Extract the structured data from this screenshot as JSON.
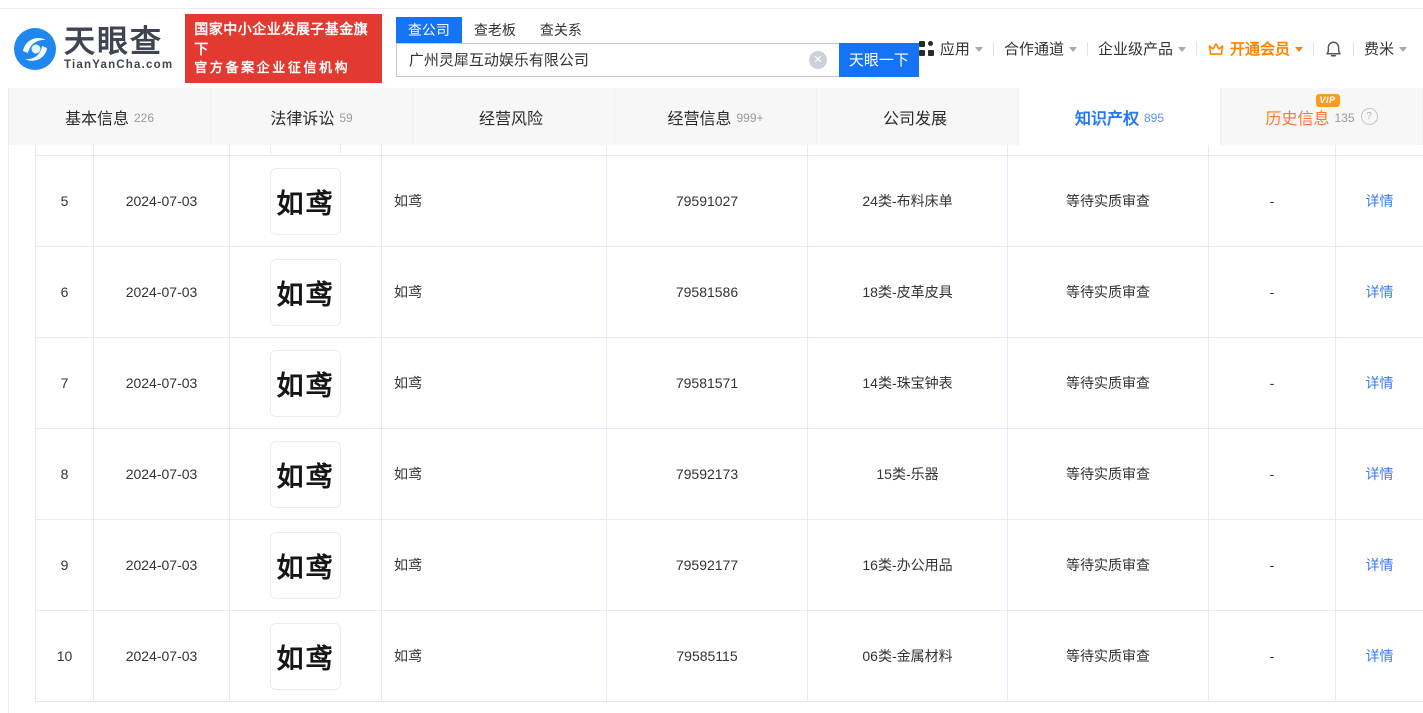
{
  "brand": {
    "logo_title": "天眼查",
    "logo_subtitle": "TianYanCha.com",
    "badge_line1": "国家中小企业发展子基金旗下",
    "badge_line2": "官方备案企业征信机构"
  },
  "search": {
    "tabs": [
      {
        "label": "查公司"
      },
      {
        "label": "查老板"
      },
      {
        "label": "查关系"
      }
    ],
    "active_tab": "查公司",
    "input_value": "广州灵犀互动娱乐有限公司",
    "button_label": "天眼一下"
  },
  "top_nav": {
    "apps": "应用",
    "cooperation": "合作通道",
    "enterprise": "企业级产品",
    "vip": "开通会员",
    "user": "费米"
  },
  "icons": {
    "clear_glyph": "✕",
    "help_glyph": "?"
  },
  "page_tabs": {
    "items": [
      {
        "label": "基本信息",
        "count": "226"
      },
      {
        "label": "法律诉讼",
        "count": "59"
      },
      {
        "label": "经营风险",
        "count": ""
      },
      {
        "label": "经营信息",
        "count": "999+"
      },
      {
        "label": "公司发展",
        "count": ""
      },
      {
        "label": "知识产权",
        "count": "895"
      },
      {
        "label": "历史信息",
        "count": "135"
      }
    ],
    "active_tab": "知识产权",
    "vip_badge": "VIP"
  },
  "table": {
    "rows": [
      {
        "no": "5",
        "date": "2024-07-03",
        "logo_text": "如鸢",
        "name": "如鸢",
        "reg_no": "79591027",
        "category": "24类-布料床单",
        "status": "等待实质审查",
        "flow": "-",
        "detail": "详情"
      },
      {
        "no": "6",
        "date": "2024-07-03",
        "logo_text": "如鸢",
        "name": "如鸢",
        "reg_no": "79581586",
        "category": "18类-皮革皮具",
        "status": "等待实质审查",
        "flow": "-",
        "detail": "详情"
      },
      {
        "no": "7",
        "date": "2024-07-03",
        "logo_text": "如鸢",
        "name": "如鸢",
        "reg_no": "79581571",
        "category": "14类-珠宝钟表",
        "status": "等待实质审查",
        "flow": "-",
        "detail": "详情"
      },
      {
        "no": "8",
        "date": "2024-07-03",
        "logo_text": "如鸢",
        "name": "如鸢",
        "reg_no": "79592173",
        "category": "15类-乐器",
        "status": "等待实质审查",
        "flow": "-",
        "detail": "详情"
      },
      {
        "no": "9",
        "date": "2024-07-03",
        "logo_text": "如鸢",
        "name": "如鸢",
        "reg_no": "79592177",
        "category": "16类-办公用品",
        "status": "等待实质审查",
        "flow": "-",
        "detail": "详情"
      },
      {
        "no": "10",
        "date": "2024-07-03",
        "logo_text": "如鸢",
        "name": "如鸢",
        "reg_no": "79585115",
        "category": "06类-金属材料",
        "status": "等待实质审查",
        "flow": "-",
        "detail": "详情"
      }
    ]
  },
  "colors": {
    "brand_blue": "#1574f6",
    "tab_active_blue": "#2478f2",
    "link_blue": "#3b7bf8",
    "orange": "#ff7733",
    "vip_badge_orange": "#ff9a1e",
    "badge_red": "#e23a30",
    "table_border": "#e4ebf6"
  }
}
